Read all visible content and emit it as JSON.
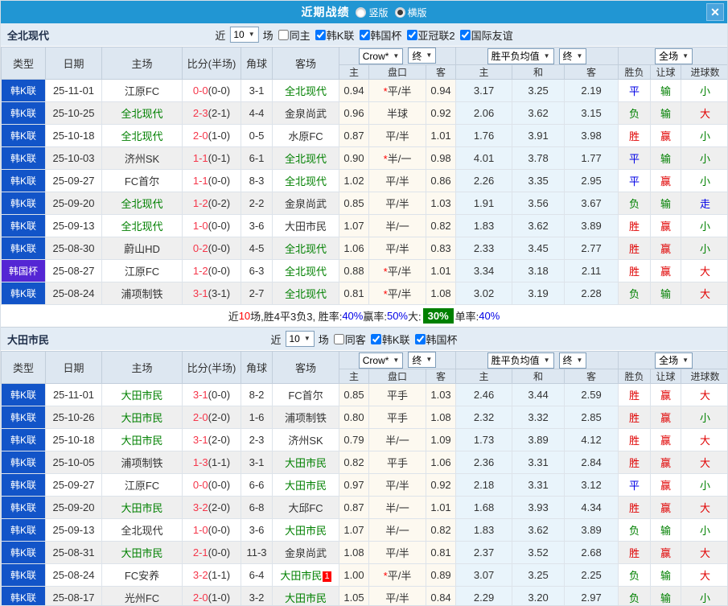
{
  "colors": {
    "accent": "#2196d3",
    "league_badge_bg": "#1254c8",
    "cup_badge_bg": "#5426d4",
    "highlight_team_green": "#008000",
    "win_red": "#e00000",
    "draw_blue": "#0000e6",
    "lose_green": "#008000",
    "score_red": "#f5364a",
    "big_pct_badge_bg": "#008000"
  },
  "titlebar": {
    "title": "近期战绩",
    "layout_options": [
      {
        "label": "竖版",
        "selected": false
      },
      {
        "label": "横版",
        "selected": true
      }
    ],
    "close_label": "✕"
  },
  "table_header": {
    "static_cols": [
      "类型",
      "日期",
      "主场",
      "比分(半场)",
      "角球",
      "客场"
    ],
    "odds_group": {
      "select_company": "Crow*",
      "select_stage": "终",
      "sub": [
        "主",
        "盘口",
        "客"
      ]
    },
    "avg_group": {
      "select_type": "胜平负均值",
      "select_stage": "终",
      "sub": [
        "主",
        "和",
        "客"
      ]
    },
    "result_group": {
      "select_scope": "全场",
      "sub": [
        "胜负",
        "让球",
        "进球数"
      ]
    }
  },
  "sections": [
    {
      "team": "全北现代",
      "filter": {
        "prefix": "近",
        "count": "10",
        "suffix": "场",
        "same_side_label": "同主",
        "same_side_checked": false,
        "leagues": [
          {
            "label": "韩K联",
            "checked": true
          },
          {
            "label": "韩国杯",
            "checked": true
          },
          {
            "label": "亚冠联2",
            "checked": true
          },
          {
            "label": "国际友谊",
            "checked": true
          }
        ]
      },
      "rows": [
        {
          "type": "韩K联",
          "cup": false,
          "date": "25-11-01",
          "home": "江原FC",
          "home_hl": false,
          "score": "0-0",
          "half": "(0-0)",
          "corners": "3-1",
          "away": "全北现代",
          "away_hl": true,
          "away_badge": "",
          "odds_home": "0.94",
          "handicap_star": true,
          "handicap": "平/半",
          "odds_away": "0.94",
          "avg_home": "3.17",
          "avg_draw": "3.25",
          "avg_away": "2.19",
          "result": "平",
          "handicap_result": "输",
          "goals": "小"
        },
        {
          "type": "韩K联",
          "cup": false,
          "date": "25-10-25",
          "home": "全北现代",
          "home_hl": true,
          "score": "2-3",
          "half": "(2-1)",
          "corners": "4-4",
          "away": "金泉尚武",
          "away_hl": false,
          "away_badge": "",
          "odds_home": "0.96",
          "handicap_star": false,
          "handicap": "半球",
          "odds_away": "0.92",
          "avg_home": "2.06",
          "avg_draw": "3.62",
          "avg_away": "3.15",
          "result": "负",
          "handicap_result": "输",
          "goals": "大"
        },
        {
          "type": "韩K联",
          "cup": false,
          "date": "25-10-18",
          "home": "全北现代",
          "home_hl": true,
          "score": "2-0",
          "half": "(1-0)",
          "corners": "0-5",
          "away": "水原FC",
          "away_hl": false,
          "away_badge": "",
          "odds_home": "0.87",
          "handicap_star": false,
          "handicap": "平/半",
          "odds_away": "1.01",
          "avg_home": "1.76",
          "avg_draw": "3.91",
          "avg_away": "3.98",
          "result": "胜",
          "handicap_result": "赢",
          "goals": "小"
        },
        {
          "type": "韩K联",
          "cup": false,
          "date": "25-10-03",
          "home": "济州SK",
          "home_hl": false,
          "score": "1-1",
          "half": "(0-1)",
          "corners": "6-1",
          "away": "全北现代",
          "away_hl": true,
          "away_badge": "",
          "odds_home": "0.90",
          "handicap_star": true,
          "handicap": "半/一",
          "odds_away": "0.98",
          "avg_home": "4.01",
          "avg_draw": "3.78",
          "avg_away": "1.77",
          "result": "平",
          "handicap_result": "输",
          "goals": "小"
        },
        {
          "type": "韩K联",
          "cup": false,
          "date": "25-09-27",
          "home": "FC首尔",
          "home_hl": false,
          "score": "1-1",
          "half": "(0-0)",
          "corners": "8-3",
          "away": "全北现代",
          "away_hl": true,
          "away_badge": "",
          "odds_home": "1.02",
          "handicap_star": false,
          "handicap": "平/半",
          "odds_away": "0.86",
          "avg_home": "2.26",
          "avg_draw": "3.35",
          "avg_away": "2.95",
          "result": "平",
          "handicap_result": "赢",
          "goals": "小"
        },
        {
          "type": "韩K联",
          "cup": false,
          "date": "25-09-20",
          "home": "全北现代",
          "home_hl": true,
          "score": "1-2",
          "half": "(0-2)",
          "corners": "2-2",
          "away": "金泉尚武",
          "away_hl": false,
          "away_badge": "",
          "odds_home": "0.85",
          "handicap_star": false,
          "handicap": "平/半",
          "odds_away": "1.03",
          "avg_home": "1.91",
          "avg_draw": "3.56",
          "avg_away": "3.67",
          "result": "负",
          "handicap_result": "输",
          "goals": "走"
        },
        {
          "type": "韩K联",
          "cup": false,
          "date": "25-09-13",
          "home": "全北现代",
          "home_hl": true,
          "score": "1-0",
          "half": "(0-0)",
          "corners": "3-6",
          "away": "大田市民",
          "away_hl": false,
          "away_badge": "",
          "odds_home": "1.07",
          "handicap_star": false,
          "handicap": "半/一",
          "odds_away": "0.82",
          "avg_home": "1.83",
          "avg_draw": "3.62",
          "avg_away": "3.89",
          "result": "胜",
          "handicap_result": "赢",
          "goals": "小"
        },
        {
          "type": "韩K联",
          "cup": false,
          "date": "25-08-30",
          "home": "蔚山HD",
          "home_hl": false,
          "score": "0-2",
          "half": "(0-0)",
          "corners": "4-5",
          "away": "全北现代",
          "away_hl": true,
          "away_badge": "",
          "odds_home": "1.06",
          "handicap_star": false,
          "handicap": "平/半",
          "odds_away": "0.83",
          "avg_home": "2.33",
          "avg_draw": "3.45",
          "avg_away": "2.77",
          "result": "胜",
          "handicap_result": "赢",
          "goals": "小"
        },
        {
          "type": "韩国杯",
          "cup": true,
          "date": "25-08-27",
          "home": "江原FC",
          "home_hl": false,
          "score": "1-2",
          "half": "(0-0)",
          "corners": "6-3",
          "away": "全北现代",
          "away_hl": true,
          "away_badge": "",
          "odds_home": "0.88",
          "handicap_star": true,
          "handicap": "平/半",
          "odds_away": "1.01",
          "avg_home": "3.34",
          "avg_draw": "3.18",
          "avg_away": "2.11",
          "result": "胜",
          "handicap_result": "赢",
          "goals": "大"
        },
        {
          "type": "韩K联",
          "cup": false,
          "date": "25-08-24",
          "home": "浦项制铁",
          "home_hl": false,
          "score": "3-1",
          "half": "(3-1)",
          "corners": "2-7",
          "away": "全北现代",
          "away_hl": true,
          "away_badge": "",
          "odds_home": "0.81",
          "handicap_star": true,
          "handicap": "平/半",
          "odds_away": "1.08",
          "avg_home": "3.02",
          "avg_draw": "3.19",
          "avg_away": "2.28",
          "result": "负",
          "handicap_result": "输",
          "goals": "大"
        }
      ],
      "summary": [
        {
          "text": "近",
          "style": "plain"
        },
        {
          "text": "10",
          "style": "red"
        },
        {
          "text": "场,胜4平3负3, 胜率:",
          "style": "plain"
        },
        {
          "text": "40%",
          "style": "blue"
        },
        {
          "text": " 赢率:",
          "style": "plain"
        },
        {
          "text": "50%",
          "style": "blue"
        },
        {
          "text": " 大:",
          "style": "plain"
        },
        {
          "text": "30%",
          "style": "green-badge"
        },
        {
          "text": " 单率:",
          "style": "plain"
        },
        {
          "text": "40%",
          "style": "blue"
        }
      ]
    },
    {
      "team": "大田市民",
      "filter": {
        "prefix": "近",
        "count": "10",
        "suffix": "场",
        "same_side_label": "同客",
        "same_side_checked": false,
        "leagues": [
          {
            "label": "韩K联",
            "checked": true
          },
          {
            "label": "韩国杯",
            "checked": true
          }
        ]
      },
      "rows": [
        {
          "type": "韩K联",
          "cup": false,
          "date": "25-11-01",
          "home": "大田市民",
          "home_hl": true,
          "score": "3-1",
          "half": "(0-0)",
          "corners": "8-2",
          "away": "FC首尔",
          "away_hl": false,
          "away_badge": "",
          "odds_home": "0.85",
          "handicap_star": false,
          "handicap": "平手",
          "odds_away": "1.03",
          "avg_home": "2.46",
          "avg_draw": "3.44",
          "avg_away": "2.59",
          "result": "胜",
          "handicap_result": "赢",
          "goals": "大"
        },
        {
          "type": "韩K联",
          "cup": false,
          "date": "25-10-26",
          "home": "大田市民",
          "home_hl": true,
          "score": "2-0",
          "half": "(2-0)",
          "corners": "1-6",
          "away": "浦项制铁",
          "away_hl": false,
          "away_badge": "",
          "odds_home": "0.80",
          "handicap_star": false,
          "handicap": "平手",
          "odds_away": "1.08",
          "avg_home": "2.32",
          "avg_draw": "3.32",
          "avg_away": "2.85",
          "result": "胜",
          "handicap_result": "赢",
          "goals": "小"
        },
        {
          "type": "韩K联",
          "cup": false,
          "date": "25-10-18",
          "home": "大田市民",
          "home_hl": true,
          "score": "3-1",
          "half": "(2-0)",
          "corners": "2-3",
          "away": "济州SK",
          "away_hl": false,
          "away_badge": "",
          "odds_home": "0.79",
          "handicap_star": false,
          "handicap": "半/一",
          "odds_away": "1.09",
          "avg_home": "1.73",
          "avg_draw": "3.89",
          "avg_away": "4.12",
          "result": "胜",
          "handicap_result": "赢",
          "goals": "大"
        },
        {
          "type": "韩K联",
          "cup": false,
          "date": "25-10-05",
          "home": "浦项制铁",
          "home_hl": false,
          "score": "1-3",
          "half": "(1-1)",
          "corners": "3-1",
          "away": "大田市民",
          "away_hl": true,
          "away_badge": "",
          "odds_home": "0.82",
          "handicap_star": false,
          "handicap": "平手",
          "odds_away": "1.06",
          "avg_home": "2.36",
          "avg_draw": "3.31",
          "avg_away": "2.84",
          "result": "胜",
          "handicap_result": "赢",
          "goals": "大"
        },
        {
          "type": "韩K联",
          "cup": false,
          "date": "25-09-27",
          "home": "江原FC",
          "home_hl": false,
          "score": "0-0",
          "half": "(0-0)",
          "corners": "6-6",
          "away": "大田市民",
          "away_hl": true,
          "away_badge": "",
          "odds_home": "0.97",
          "handicap_star": false,
          "handicap": "平/半",
          "odds_away": "0.92",
          "avg_home": "2.18",
          "avg_draw": "3.31",
          "avg_away": "3.12",
          "result": "平",
          "handicap_result": "赢",
          "goals": "小"
        },
        {
          "type": "韩K联",
          "cup": false,
          "date": "25-09-20",
          "home": "大田市民",
          "home_hl": true,
          "score": "3-2",
          "half": "(2-0)",
          "corners": "6-8",
          "away": "大邱FC",
          "away_hl": false,
          "away_badge": "",
          "odds_home": "0.87",
          "handicap_star": false,
          "handicap": "半/一",
          "odds_away": "1.01",
          "avg_home": "1.68",
          "avg_draw": "3.93",
          "avg_away": "4.34",
          "result": "胜",
          "handicap_result": "赢",
          "goals": "大"
        },
        {
          "type": "韩K联",
          "cup": false,
          "date": "25-09-13",
          "home": "全北现代",
          "home_hl": false,
          "score": "1-0",
          "half": "(0-0)",
          "corners": "3-6",
          "away": "大田市民",
          "away_hl": true,
          "away_badge": "",
          "odds_home": "1.07",
          "handicap_star": false,
          "handicap": "半/一",
          "odds_away": "0.82",
          "avg_home": "1.83",
          "avg_draw": "3.62",
          "avg_away": "3.89",
          "result": "负",
          "handicap_result": "输",
          "goals": "小"
        },
        {
          "type": "韩K联",
          "cup": false,
          "date": "25-08-31",
          "home": "大田市民",
          "home_hl": true,
          "score": "2-1",
          "half": "(0-0)",
          "corners": "11-3",
          "away": "金泉尚武",
          "away_hl": false,
          "away_badge": "",
          "odds_home": "1.08",
          "handicap_star": false,
          "handicap": "平/半",
          "odds_away": "0.81",
          "avg_home": "2.37",
          "avg_draw": "3.52",
          "avg_away": "2.68",
          "result": "胜",
          "handicap_result": "赢",
          "goals": "大"
        },
        {
          "type": "韩K联",
          "cup": false,
          "date": "25-08-24",
          "home": "FC安养",
          "home_hl": false,
          "score": "3-2",
          "half": "(1-1)",
          "corners": "6-4",
          "away": "大田市民",
          "away_hl": true,
          "away_badge": "1",
          "odds_home": "1.00",
          "handicap_star": true,
          "handicap": "平/半",
          "odds_away": "0.89",
          "avg_home": "3.07",
          "avg_draw": "3.25",
          "avg_away": "2.25",
          "result": "负",
          "handicap_result": "输",
          "goals": "大"
        },
        {
          "type": "韩K联",
          "cup": false,
          "date": "25-08-17",
          "home": "光州FC",
          "home_hl": false,
          "score": "2-0",
          "half": "(1-0)",
          "corners": "3-2",
          "away": "大田市民",
          "away_hl": true,
          "away_badge": "",
          "odds_home": "1.05",
          "handicap_star": false,
          "handicap": "平/半",
          "odds_away": "0.84",
          "avg_home": "2.29",
          "avg_draw": "3.20",
          "avg_away": "2.97",
          "result": "负",
          "handicap_result": "输",
          "goals": "小"
        }
      ],
      "summary": []
    }
  ]
}
